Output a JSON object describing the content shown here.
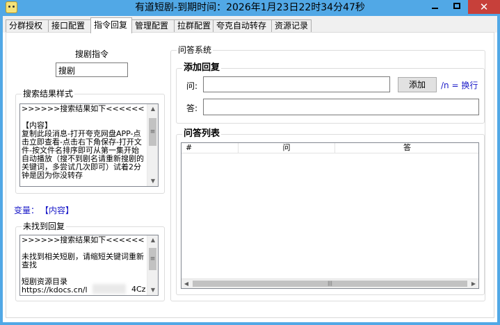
{
  "window": {
    "title": "有道短剧-到期时间：2026年1月23日22时34分47秒"
  },
  "tabs": [
    {
      "label": "分群授权"
    },
    {
      "label": "接口配置"
    },
    {
      "label": "指令回复"
    },
    {
      "label": "管理配置"
    },
    {
      "label": "拉群配置"
    },
    {
      "label": "夸克自动转存"
    },
    {
      "label": "资源记录"
    }
  ],
  "search_command": {
    "label": "搜剧指令",
    "value": "搜剧"
  },
  "search_result_style": {
    "title": "搜索结果样式",
    "text": ">>>>>>搜索结果如下<<<<<<\n\n【内容】\n复制此段消息-打开夸克网盘APP-点击立即查看-点击右下角保存-打开文件-按文件名排序即可从第一集开始自动播放（搜不到剧名请重新搜剧的关键词，多尝试几次即可）试着2分钟是因为你没转存"
  },
  "variable": {
    "label": "变量：",
    "value": "【内容】"
  },
  "not_found_reply": {
    "title": "未找到回复",
    "text": ">>>>>>搜索结果如下<<<<<<\n\n未找到相关短剧，请缩短关键词重新查找\n\n短剧资源目录\nhttps://kdocs.cn/l",
    "url_tail": "4Cz"
  },
  "qa_system": {
    "title": "问答系统",
    "add_reply": {
      "title": "添加回复",
      "question_label": "问:",
      "question_value": "",
      "add_button": "添加",
      "hint": "/n = 换行",
      "answer_label": "答:",
      "answer_value": ""
    },
    "qa_list": {
      "title": "问答列表",
      "columns": [
        "#",
        "问",
        "答"
      ],
      "rows": []
    }
  }
}
